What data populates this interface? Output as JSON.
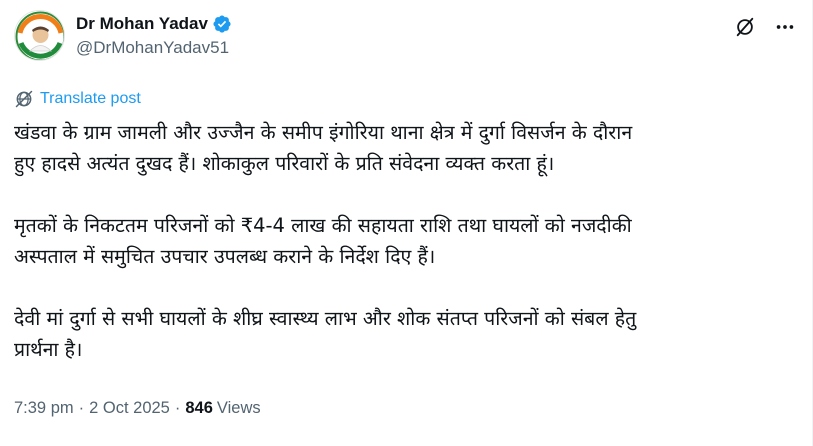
{
  "author": {
    "display_name": "Dr Mohan Yadav",
    "handle": "@DrMohanYadav51",
    "avatar_icon": "profile-avatar-logo",
    "verified_icon": "verified-badge-icon",
    "verified_color": "#1d9bf0"
  },
  "header_actions": {
    "grok_icon": "grok-icon",
    "more_icon": "more-options-icon"
  },
  "translate": {
    "label": "Translate post",
    "icon": "translate-globe-icon",
    "color": "#1d9bf0"
  },
  "post": {
    "paragraphs": [
      {
        "lines": [
          "खंडवा के ग्राम जामली और उज्जैन के समीप इंगोरिया थाना क्षेत्र में दुर्गा विसर्जन के दौरान",
          "हुए हादसे अत्यंत दुखद हैं। शोकाकुल परिवारों के प्रति संवेदना व्यक्त करता हूं।"
        ]
      },
      {
        "lines": [
          "मृतकों के निकटतम परिजनों को ₹4-4 लाख की सहायता राशि तथा घायलों को नजदीकी",
          "अस्पताल में समुचित उपचार उपलब्ध कराने के निर्देश दिए हैं।"
        ]
      },
      {
        "lines": [
          "देवी मां दुर्गा से सभी घायलों के शीघ्र स्वास्थ्य लाभ और शोक संतप्त परिजनों को संबल हेतु",
          "प्रार्थना है।"
        ]
      }
    ]
  },
  "meta": {
    "time": "7:39 pm",
    "date": "2 Oct 2025",
    "separator": "·",
    "views_count": "846",
    "views_label": "Views"
  }
}
